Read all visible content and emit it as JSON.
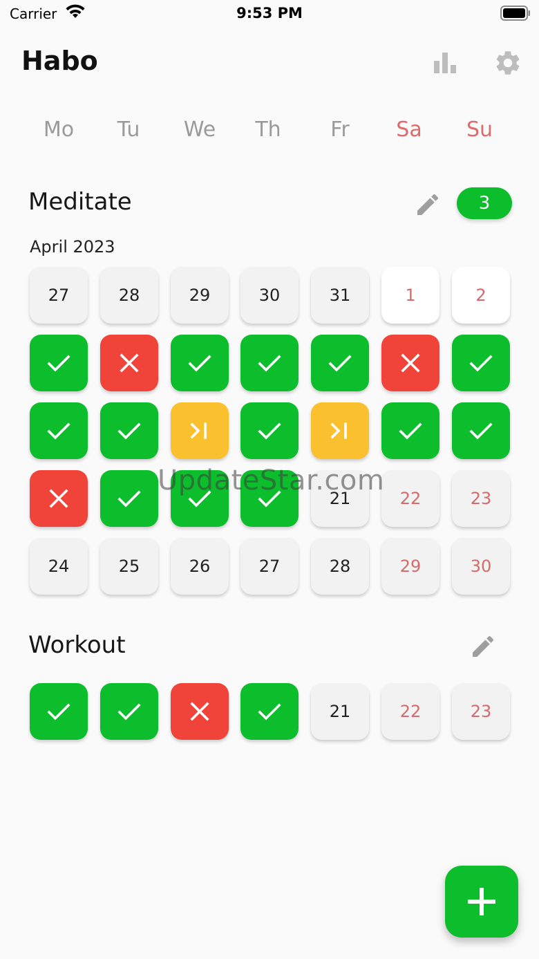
{
  "status_bar": {
    "carrier": "Carrier",
    "time": "9:53 PM"
  },
  "header": {
    "title": "Habo",
    "stats_icon": "bar-chart-icon",
    "settings_icon": "gear-icon"
  },
  "weekdays": [
    {
      "label": "Mo",
      "weekend": false
    },
    {
      "label": "Tu",
      "weekend": false
    },
    {
      "label": "We",
      "weekend": false
    },
    {
      "label": "Th",
      "weekend": false
    },
    {
      "label": "Fr",
      "weekend": false
    },
    {
      "label": "Sa",
      "weekend": true
    },
    {
      "label": "Su",
      "weekend": true
    }
  ],
  "colors": {
    "check": "#0cbd2c",
    "fail": "#f0443b",
    "skip": "#fbc02d",
    "weekend": "#de6b6b"
  },
  "habits": [
    {
      "name": "Meditate",
      "streak": "3",
      "month": "April 2023",
      "rows": [
        [
          {
            "s": "empty",
            "t": "27"
          },
          {
            "s": "empty",
            "t": "28"
          },
          {
            "s": "empty",
            "t": "29"
          },
          {
            "s": "empty",
            "t": "30"
          },
          {
            "s": "empty",
            "t": "31"
          },
          {
            "s": "future",
            "t": "1"
          },
          {
            "s": "future",
            "t": "2"
          }
        ],
        [
          {
            "s": "check"
          },
          {
            "s": "fail"
          },
          {
            "s": "check"
          },
          {
            "s": "check"
          },
          {
            "s": "check"
          },
          {
            "s": "fail"
          },
          {
            "s": "check"
          }
        ],
        [
          {
            "s": "check"
          },
          {
            "s": "check"
          },
          {
            "s": "skip"
          },
          {
            "s": "check"
          },
          {
            "s": "skip"
          },
          {
            "s": "check"
          },
          {
            "s": "check"
          }
        ],
        [
          {
            "s": "fail"
          },
          {
            "s": "check"
          },
          {
            "s": "check"
          },
          {
            "s": "check"
          },
          {
            "s": "empty",
            "t": "21"
          },
          {
            "s": "empty",
            "t": "22",
            "w": true
          },
          {
            "s": "empty",
            "t": "23",
            "w": true
          }
        ],
        [
          {
            "s": "empty",
            "t": "24"
          },
          {
            "s": "empty",
            "t": "25"
          },
          {
            "s": "empty",
            "t": "26"
          },
          {
            "s": "empty",
            "t": "27"
          },
          {
            "s": "empty",
            "t": "28"
          },
          {
            "s": "empty",
            "t": "29",
            "w": true
          },
          {
            "s": "empty",
            "t": "30",
            "w": true
          }
        ]
      ]
    },
    {
      "name": "Workout",
      "rows": [
        [
          {
            "s": "check"
          },
          {
            "s": "check"
          },
          {
            "s": "fail"
          },
          {
            "s": "check"
          },
          {
            "s": "empty",
            "t": "21"
          },
          {
            "s": "empty",
            "t": "22",
            "w": true
          },
          {
            "s": "empty",
            "t": "23",
            "w": true
          }
        ]
      ]
    }
  ],
  "watermark": "UpdateStar.com",
  "fab": {
    "icon": "plus-icon"
  }
}
